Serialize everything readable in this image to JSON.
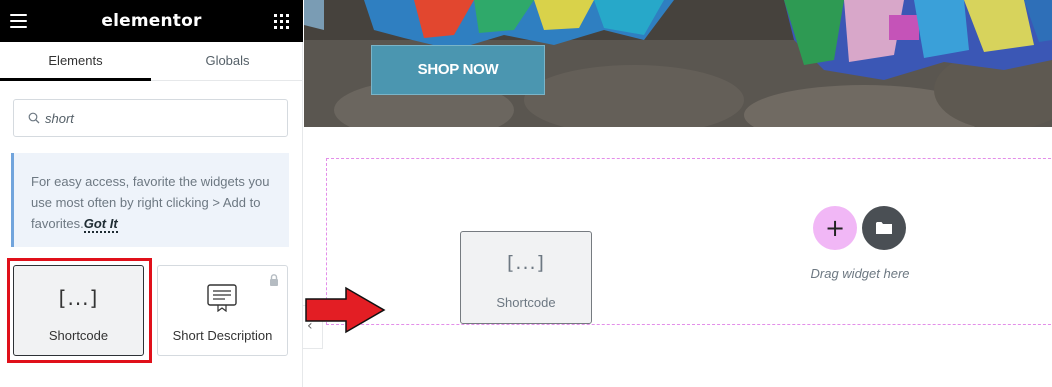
{
  "app": {
    "brand": "elementor",
    "menu_icon": "hamburger-menu-icon",
    "apps_icon": "grid-apps-icon"
  },
  "tabs": [
    {
      "label": "Elements",
      "active": true
    },
    {
      "label": "Globals",
      "active": false
    }
  ],
  "search": {
    "value": "short",
    "icon": "search-icon"
  },
  "notice": {
    "text": "For easy access, favorite the widgets you use most often by right clicking > Add to favorites.",
    "action": "Got It"
  },
  "widgets": [
    {
      "label": "Shortcode",
      "icon_text": "[...]",
      "highlighted": true
    },
    {
      "label": "Short Description",
      "icon": "description-icon",
      "locked": true
    }
  ],
  "canvas": {
    "shop_button": "SHOP NOW",
    "drag_hint": "Drag widget here",
    "dragging_widget": {
      "label": "Shortcode",
      "icon_text": "[...]"
    }
  },
  "colors": {
    "accent_pink": "#f1b7f6",
    "highlight_red": "#e0101a",
    "shop_button": "#4b96b0",
    "dropzone_border": "#e38ee9"
  }
}
